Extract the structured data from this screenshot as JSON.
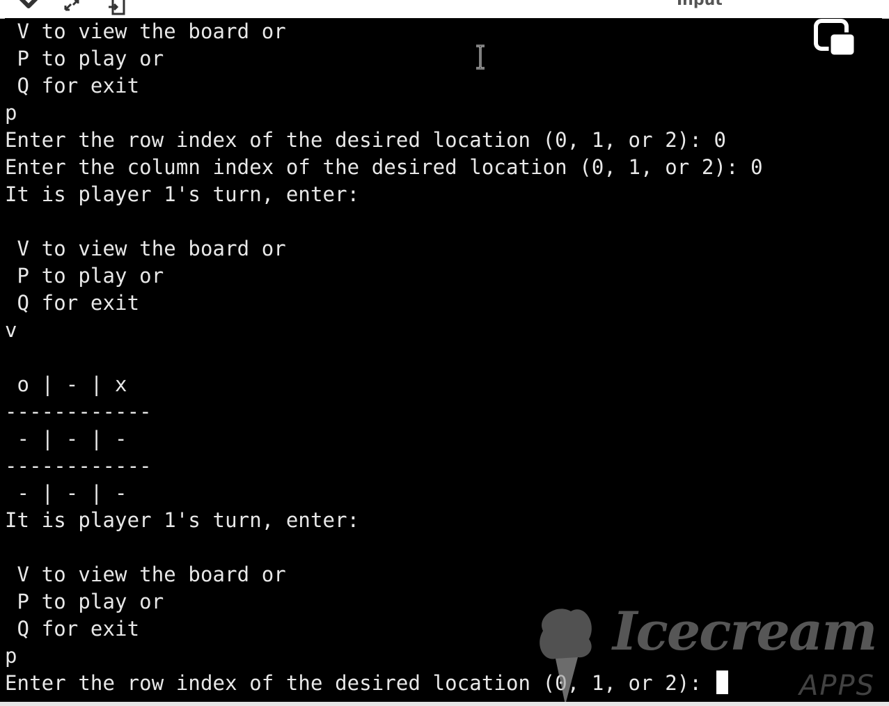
{
  "toolbar": {
    "label": "Input",
    "icons": [
      "chevron-down-icon",
      "expand-arrows-icon",
      "exit-door-icon"
    ]
  },
  "terminal": {
    "lines": [
      " V to view the board or",
      " P to play or",
      " Q for exit",
      "p",
      "Enter the row index of the desired location (0, 1, or 2): 0",
      "Enter the column index of the desired location (0, 1, or 2): 0",
      "It is player 1's turn, enter:",
      "",
      " V to view the board or",
      " P to play or",
      " Q for exit",
      "v",
      "",
      " o | - | x",
      "------------",
      " - | - | -",
      "------------",
      " - | - | -",
      "It is player 1's turn, enter:",
      "",
      " V to view the board or",
      " P to play or",
      " Q for exit",
      "p",
      "Enter the row index of the desired location (0, 1, or 2): "
    ]
  },
  "overlay": {
    "icons": [
      "text-cursor-icon",
      "picture-in-picture-icon"
    ]
  },
  "watermark": {
    "brand": "Icecream",
    "sub": "APPS"
  },
  "colors": {
    "terminal_bg": "#000000",
    "terminal_fg": "#e8e8e8",
    "toolbar_bg": "#ffffff"
  }
}
